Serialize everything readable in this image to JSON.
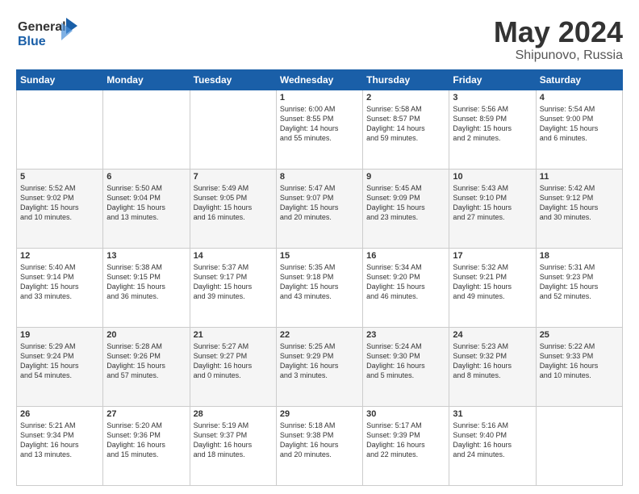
{
  "logo": {
    "line1": "General",
    "line2": "Blue"
  },
  "title": "May 2024",
  "subtitle": "Shipunovo, Russia",
  "days": [
    "Sunday",
    "Monday",
    "Tuesday",
    "Wednesday",
    "Thursday",
    "Friday",
    "Saturday"
  ],
  "weeks": [
    [
      {
        "day": "",
        "content": ""
      },
      {
        "day": "",
        "content": ""
      },
      {
        "day": "",
        "content": ""
      },
      {
        "day": "1",
        "content": "Sunrise: 6:00 AM\nSunset: 8:55 PM\nDaylight: 14 hours\nand 55 minutes."
      },
      {
        "day": "2",
        "content": "Sunrise: 5:58 AM\nSunset: 8:57 PM\nDaylight: 14 hours\nand 59 minutes."
      },
      {
        "day": "3",
        "content": "Sunrise: 5:56 AM\nSunset: 8:59 PM\nDaylight: 15 hours\nand 2 minutes."
      },
      {
        "day": "4",
        "content": "Sunrise: 5:54 AM\nSunset: 9:00 PM\nDaylight: 15 hours\nand 6 minutes."
      }
    ],
    [
      {
        "day": "5",
        "content": "Sunrise: 5:52 AM\nSunset: 9:02 PM\nDaylight: 15 hours\nand 10 minutes."
      },
      {
        "day": "6",
        "content": "Sunrise: 5:50 AM\nSunset: 9:04 PM\nDaylight: 15 hours\nand 13 minutes."
      },
      {
        "day": "7",
        "content": "Sunrise: 5:49 AM\nSunset: 9:05 PM\nDaylight: 15 hours\nand 16 minutes."
      },
      {
        "day": "8",
        "content": "Sunrise: 5:47 AM\nSunset: 9:07 PM\nDaylight: 15 hours\nand 20 minutes."
      },
      {
        "day": "9",
        "content": "Sunrise: 5:45 AM\nSunset: 9:09 PM\nDaylight: 15 hours\nand 23 minutes."
      },
      {
        "day": "10",
        "content": "Sunrise: 5:43 AM\nSunset: 9:10 PM\nDaylight: 15 hours\nand 27 minutes."
      },
      {
        "day": "11",
        "content": "Sunrise: 5:42 AM\nSunset: 9:12 PM\nDaylight: 15 hours\nand 30 minutes."
      }
    ],
    [
      {
        "day": "12",
        "content": "Sunrise: 5:40 AM\nSunset: 9:14 PM\nDaylight: 15 hours\nand 33 minutes."
      },
      {
        "day": "13",
        "content": "Sunrise: 5:38 AM\nSunset: 9:15 PM\nDaylight: 15 hours\nand 36 minutes."
      },
      {
        "day": "14",
        "content": "Sunrise: 5:37 AM\nSunset: 9:17 PM\nDaylight: 15 hours\nand 39 minutes."
      },
      {
        "day": "15",
        "content": "Sunrise: 5:35 AM\nSunset: 9:18 PM\nDaylight: 15 hours\nand 43 minutes."
      },
      {
        "day": "16",
        "content": "Sunrise: 5:34 AM\nSunset: 9:20 PM\nDaylight: 15 hours\nand 46 minutes."
      },
      {
        "day": "17",
        "content": "Sunrise: 5:32 AM\nSunset: 9:21 PM\nDaylight: 15 hours\nand 49 minutes."
      },
      {
        "day": "18",
        "content": "Sunrise: 5:31 AM\nSunset: 9:23 PM\nDaylight: 15 hours\nand 52 minutes."
      }
    ],
    [
      {
        "day": "19",
        "content": "Sunrise: 5:29 AM\nSunset: 9:24 PM\nDaylight: 15 hours\nand 54 minutes."
      },
      {
        "day": "20",
        "content": "Sunrise: 5:28 AM\nSunset: 9:26 PM\nDaylight: 15 hours\nand 57 minutes."
      },
      {
        "day": "21",
        "content": "Sunrise: 5:27 AM\nSunset: 9:27 PM\nDaylight: 16 hours\nand 0 minutes."
      },
      {
        "day": "22",
        "content": "Sunrise: 5:25 AM\nSunset: 9:29 PM\nDaylight: 16 hours\nand 3 minutes."
      },
      {
        "day": "23",
        "content": "Sunrise: 5:24 AM\nSunset: 9:30 PM\nDaylight: 16 hours\nand 5 minutes."
      },
      {
        "day": "24",
        "content": "Sunrise: 5:23 AM\nSunset: 9:32 PM\nDaylight: 16 hours\nand 8 minutes."
      },
      {
        "day": "25",
        "content": "Sunrise: 5:22 AM\nSunset: 9:33 PM\nDaylight: 16 hours\nand 10 minutes."
      }
    ],
    [
      {
        "day": "26",
        "content": "Sunrise: 5:21 AM\nSunset: 9:34 PM\nDaylight: 16 hours\nand 13 minutes."
      },
      {
        "day": "27",
        "content": "Sunrise: 5:20 AM\nSunset: 9:36 PM\nDaylight: 16 hours\nand 15 minutes."
      },
      {
        "day": "28",
        "content": "Sunrise: 5:19 AM\nSunset: 9:37 PM\nDaylight: 16 hours\nand 18 minutes."
      },
      {
        "day": "29",
        "content": "Sunrise: 5:18 AM\nSunset: 9:38 PM\nDaylight: 16 hours\nand 20 minutes."
      },
      {
        "day": "30",
        "content": "Sunrise: 5:17 AM\nSunset: 9:39 PM\nDaylight: 16 hours\nand 22 minutes."
      },
      {
        "day": "31",
        "content": "Sunrise: 5:16 AM\nSunset: 9:40 PM\nDaylight: 16 hours\nand 24 minutes."
      },
      {
        "day": "",
        "content": ""
      }
    ]
  ]
}
